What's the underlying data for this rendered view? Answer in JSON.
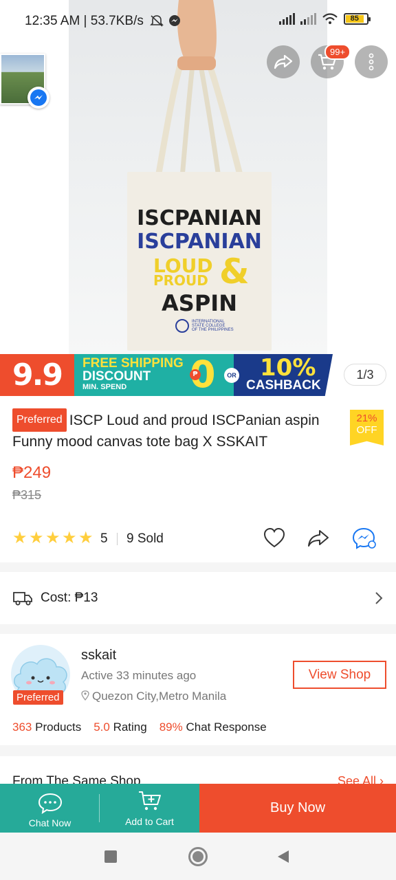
{
  "status_bar": {
    "time": "12:35 AM | 53.7KB/s",
    "battery": "85"
  },
  "header": {
    "cart_badge": "99+"
  },
  "product_image": {
    "bag_lines": [
      "ISCPANIAN",
      "ISCPANIAN",
      "LOUD",
      "PROUD",
      "&",
      "ASPIN"
    ],
    "bag_footer": [
      "INTERNATIONAL",
      "STATE COLLEGE",
      "OF THE PHILIPPINES"
    ],
    "pager": "1/3"
  },
  "promo": {
    "sale_label": "9.9",
    "free_shipping": "FREE SHIPPING",
    "discount": "DISCOUNT",
    "min_spend": "MIN. SPEND",
    "currency_badge": "₱",
    "zero": "0",
    "or": "OR",
    "cashback_pct": "10%",
    "cashback": "CASHBACK"
  },
  "product": {
    "badge": "Preferred",
    "title": "ISCP Loud and proud ISCPanian aspin Funny mood canvas tote bag X SSKAIT",
    "discount_pct": "21%",
    "discount_label": "OFF",
    "price": "₱249",
    "old_price": "₱315",
    "rating": "5",
    "rating_value": 5,
    "sold": "9 Sold"
  },
  "shipping": {
    "cost": "Cost: ₱13"
  },
  "shop": {
    "name": "sskait",
    "active": "Active 33 minutes ago",
    "location": "Quezon City,Metro Manila",
    "badge": "Preferred",
    "view_shop": "View Shop",
    "products_num": "363",
    "products_label": "Products",
    "rating_num": "5.0",
    "rating_label": "Rating",
    "chat_num": "89%",
    "chat_label": "Chat Response"
  },
  "same_shop": {
    "title": "From The Same Shop",
    "see_all": "See All"
  },
  "bottom_bar": {
    "chat": "Chat Now",
    "cart": "Add to Cart",
    "buy": "Buy Now"
  },
  "colors": {
    "brand": "#ee4d2d",
    "teal": "#26aa99",
    "star": "#ffce3d"
  }
}
